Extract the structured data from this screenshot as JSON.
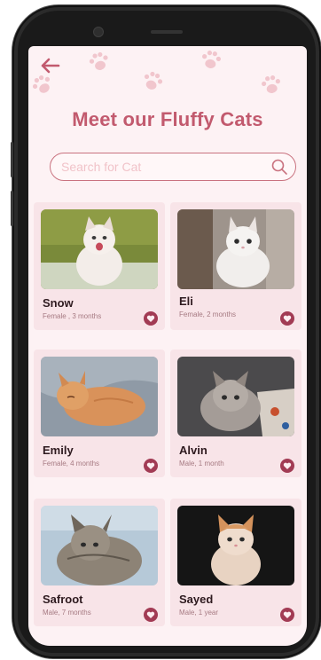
{
  "header": {
    "back_icon": "arrow-left-icon",
    "title": "Meet our Fluffy Cats"
  },
  "search": {
    "placeholder": "Search for Cat",
    "value": "",
    "icon": "search-icon"
  },
  "colors": {
    "accent": "#c25a6e",
    "card_bg": "#f8e4e8",
    "screen_bg": "#fdf2f4",
    "heart": "#a23b54"
  },
  "cats": [
    {
      "name": "Snow",
      "info": "Female , 3 months"
    },
    {
      "name": "Eli",
      "info": "Female, 2 months"
    },
    {
      "name": "Emily",
      "info": "Female, 4 months"
    },
    {
      "name": "Alvin",
      "info": "Male, 1 month"
    },
    {
      "name": "Safroot",
      "info": "Male, 7 months"
    },
    {
      "name": "Sayed",
      "info": "Male, 1 year"
    }
  ]
}
